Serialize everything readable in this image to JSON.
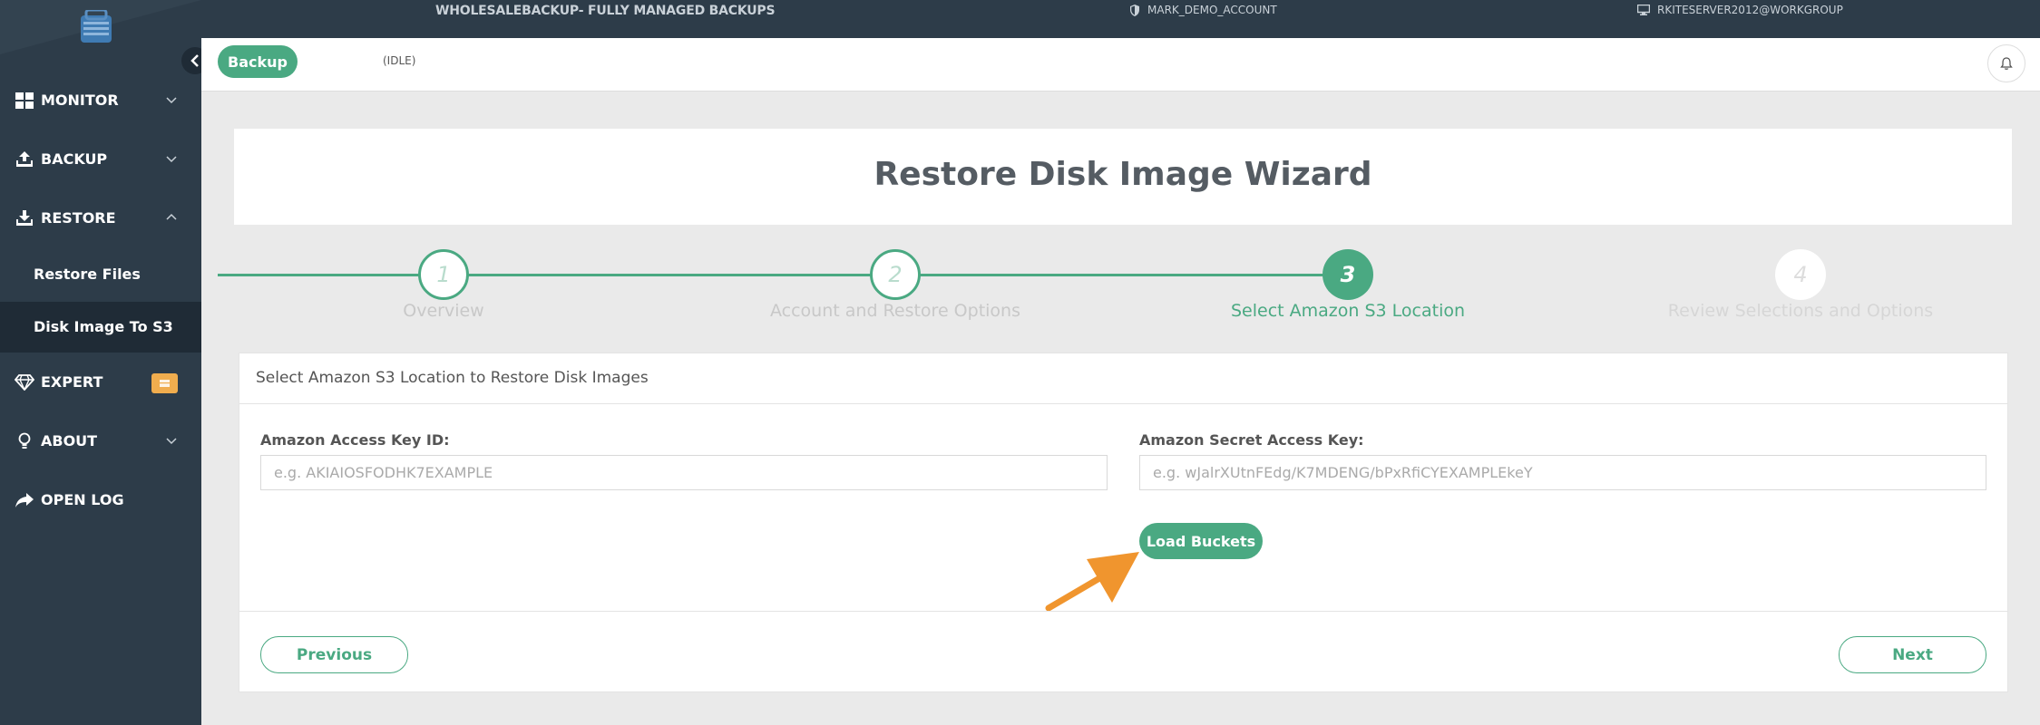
{
  "topbar": {
    "title": "WHOLESALEBACKUP- FULLY MANAGED BACKUPS",
    "account": "MARK_DEMO_ACCOUNT",
    "server": "RKITESERVER2012@WORKGROUP"
  },
  "sidebar": {
    "items": [
      {
        "label": "MONITOR",
        "icon": "grid-icon"
      },
      {
        "label": "BACKUP",
        "icon": "upload-icon"
      },
      {
        "label": "RESTORE",
        "icon": "download-icon"
      },
      {
        "label": "EXPERT",
        "icon": "diamond-icon"
      },
      {
        "label": "ABOUT",
        "icon": "lightbulb-icon"
      },
      {
        "label": "OPEN LOG",
        "icon": "share-icon"
      }
    ],
    "restore_sub": [
      "Restore Files",
      "Disk Image To S3"
    ]
  },
  "header": {
    "backup_label": "Backup",
    "status": "(IDLE)"
  },
  "wizard": {
    "title": "Restore Disk Image Wizard",
    "steps": [
      {
        "number": "1",
        "label": "Overview",
        "state": "done"
      },
      {
        "number": "2",
        "label": "Account and Restore Options",
        "state": "done"
      },
      {
        "number": "3",
        "label": "Select Amazon S3 Location",
        "state": "current"
      },
      {
        "number": "4",
        "label": "Review Selections and Options",
        "state": "future"
      }
    ]
  },
  "form": {
    "heading": "Select Amazon S3 Location to Restore Disk Images",
    "access_key_label": "Amazon Access Key ID:",
    "access_key_placeholder": "e.g. AKIAIOSFODHK7EXAMPLE",
    "access_key_value": "",
    "secret_key_label": "Amazon Secret Access Key:",
    "secret_key_placeholder": "e.g. wJalrXUtnFEdg/K7MDENG/bPxRfiCYEXAMPLEkeY",
    "secret_key_value": "",
    "load_buckets_label": "Load Buckets",
    "previous_label": "Previous",
    "next_label": "Next"
  },
  "colors": {
    "accent": "#4aa982",
    "sidebar_bg": "#2d3c49",
    "annotation_arrow": "#f0952e",
    "badge": "#f0ad4e"
  }
}
